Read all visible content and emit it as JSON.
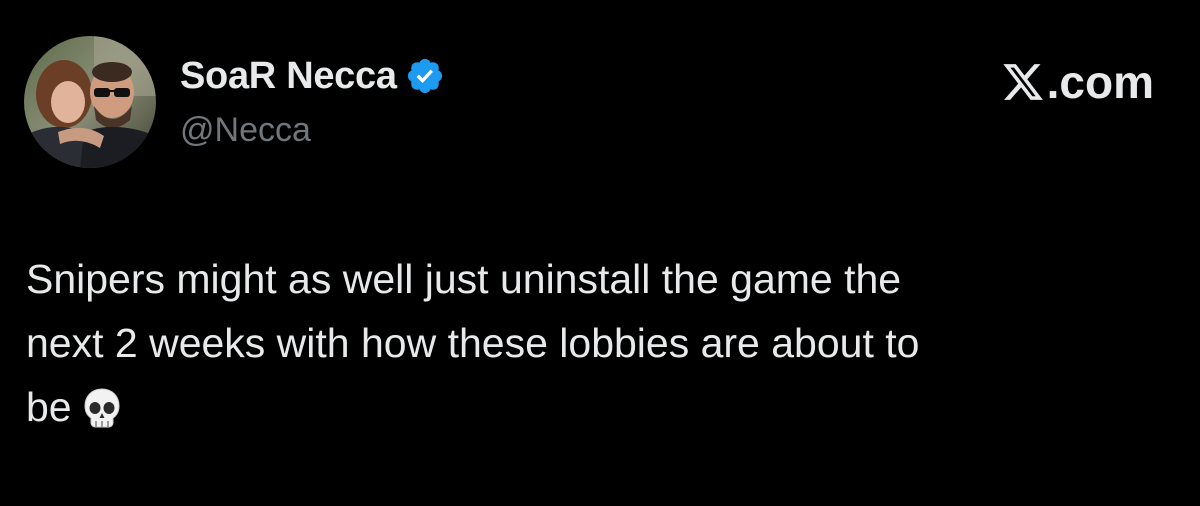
{
  "tweet": {
    "author": {
      "display_name": "SoaR Necca",
      "handle": "@Necca",
      "verified": true,
      "avatar_icon": "profile-photo"
    },
    "brand": {
      "icon": "x-logo-icon",
      "text": ".com"
    },
    "body_lines": [
      "Snipers might as well just uninstall the game the",
      "next 2 weeks with how these lobbies are about to",
      "be"
    ],
    "emoji": "skull-emoji"
  },
  "colors": {
    "background": "#000000",
    "primary_text": "#e7e9ea",
    "secondary_text": "#71767b",
    "verified_badge": "#1d9bf0"
  }
}
